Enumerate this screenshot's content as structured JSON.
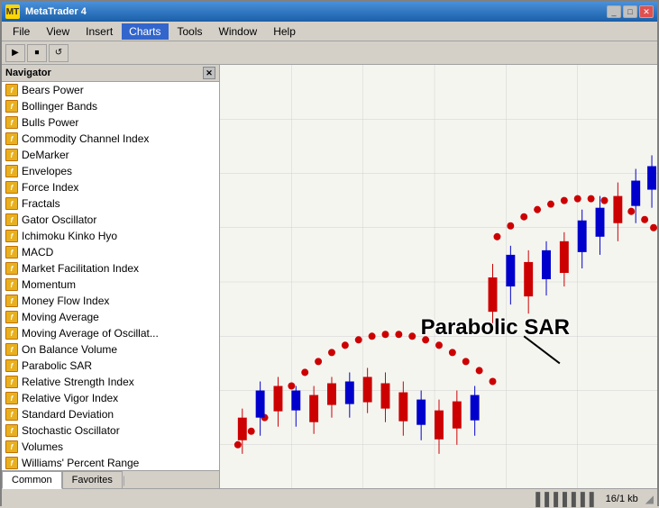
{
  "titleBar": {
    "title": "MetaTrader 4",
    "iconLabel": "MT",
    "controls": [
      "_",
      "□",
      "✕"
    ]
  },
  "menuBar": {
    "items": [
      "File",
      "View",
      "Insert",
      "Charts",
      "Tools",
      "Window",
      "Help"
    ],
    "activeItem": "Charts"
  },
  "navigator": {
    "title": "Navigator",
    "indicators": [
      "Bears Power",
      "Bollinger Bands",
      "Bulls Power",
      "Commodity Channel Index",
      "DeMarker",
      "Envelopes",
      "Force Index",
      "Fractals",
      "Gator Oscillator",
      "Ichimoku Kinko Hyo",
      "MACD",
      "Market Facilitation Index",
      "Momentum",
      "Money Flow Index",
      "Moving Average",
      "Moving Average of Oscillat...",
      "On Balance Volume",
      "Parabolic SAR",
      "Relative Strength Index",
      "Relative Vigor Index",
      "Standard Deviation",
      "Stochastic Oscillator",
      "Volumes",
      "Williams' Percent Range"
    ],
    "tabs": [
      "Common",
      "Favorites"
    ],
    "activeTab": "Common"
  },
  "chart": {
    "sarLabel": "Parabolic SAR"
  },
  "statusBar": {
    "leftText": "",
    "rightInfo": "16/1 kb",
    "iconText": "||||||||"
  }
}
